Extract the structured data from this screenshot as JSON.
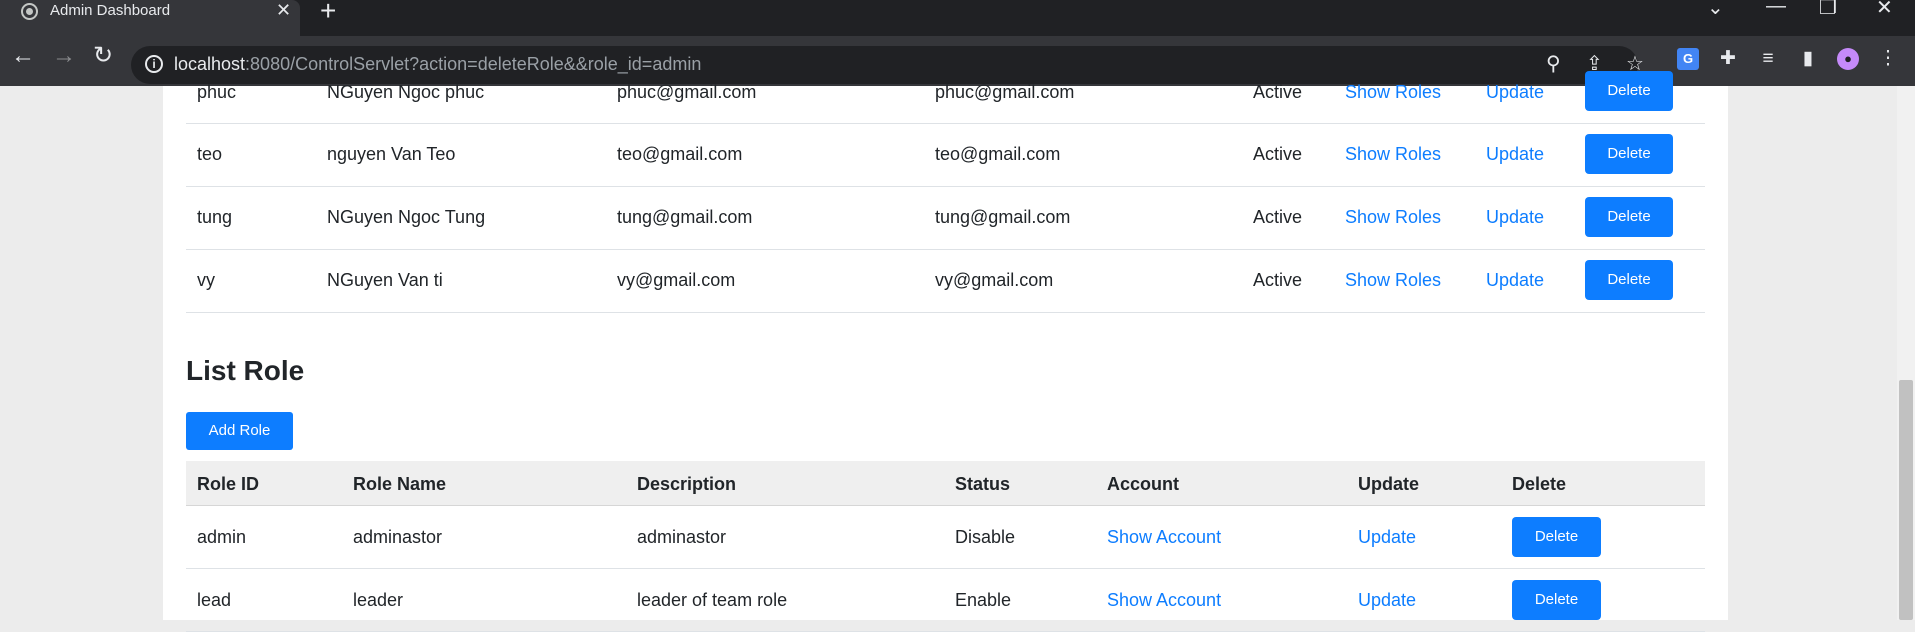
{
  "browser": {
    "tab_title": "Admin Dashboard",
    "url_host": "localhost",
    "url_rest": ":8080/ControlServlet?action=deleteRole&&role_id=admin"
  },
  "users": [
    {
      "id": "phuc",
      "name": "NGuyen Ngoc phuc",
      "email": "phuc@gmail.com",
      "email2": "phuc@gmail.com",
      "status": "Active",
      "show": "Show Roles",
      "update": "Update",
      "delete": "Delete"
    },
    {
      "id": "teo",
      "name": "nguyen Van Teo",
      "email": "teo@gmail.com",
      "email2": "teo@gmail.com",
      "status": "Active",
      "show": "Show Roles",
      "update": "Update",
      "delete": "Delete"
    },
    {
      "id": "tung",
      "name": "NGuyen Ngoc Tung",
      "email": "tung@gmail.com",
      "email2": "tung@gmail.com",
      "status": "Active",
      "show": "Show Roles",
      "update": "Update",
      "delete": "Delete"
    },
    {
      "id": "vy",
      "name": "NGuyen Van ti",
      "email": "vy@gmail.com",
      "email2": "vy@gmail.com",
      "status": "Active",
      "show": "Show Roles",
      "update": "Update",
      "delete": "Delete"
    }
  ],
  "roles_section": {
    "title": "List Role",
    "add_label": "Add Role",
    "headers": [
      "Role ID",
      "Role Name",
      "Description",
      "Status",
      "Account",
      "Update",
      "Delete"
    ],
    "rows": [
      {
        "id": "admin",
        "name": "adminastor",
        "desc": "adminastor",
        "status": "Disable",
        "account": "Show Account",
        "update": "Update",
        "delete": "Delete"
      },
      {
        "id": "lead",
        "name": "leader",
        "desc": "leader of team role",
        "status": "Enable",
        "account": "Show Account",
        "update": "Update",
        "delete": "Delete"
      }
    ]
  },
  "colors": {
    "primary": "#0d7dff",
    "link": "#0d7dff",
    "chrome_dark": "#202124",
    "chrome_mid": "#35363a"
  },
  "icons": [
    "globe-icon",
    "close-icon",
    "plus-icon",
    "back-icon",
    "forward-icon",
    "reload-icon",
    "info-icon",
    "zoom-icon",
    "share-icon",
    "star-icon",
    "translate-icon",
    "puzzle-icon",
    "media-icon",
    "sidepanel-icon",
    "profile-icon",
    "menu-icon"
  ]
}
